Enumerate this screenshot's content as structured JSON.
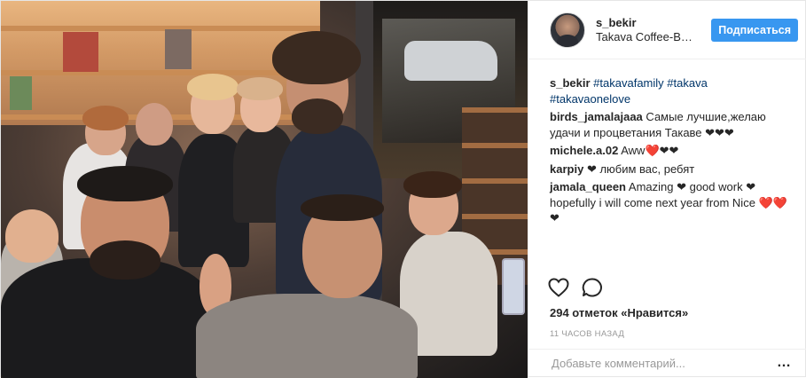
{
  "header": {
    "username": "s_bekir",
    "location": "Takava Coffee-B…",
    "follow_label": "Подписаться"
  },
  "caption": {
    "username": "s_bekir",
    "tags": [
      "#takavafamily",
      "#takava",
      "#takavaonelove"
    ]
  },
  "comments": [
    {
      "username": "birds_jamalajaaa",
      "text": "Самые лучшие,желаю удачи и процветания Такаве ❤❤❤"
    },
    {
      "username": "michele.a.02",
      "text": "Aww❤️❤❤"
    },
    {
      "username": "karpiy",
      "text": "❤ любим вас, ребят"
    },
    {
      "username": "jamala_queen",
      "text": "Amazing ❤ good work ❤ hopefully i will come next year from Nice ❤️❤️ ❤"
    }
  ],
  "actions": {
    "like_icon": "heart-icon",
    "comment_icon": "comment-icon"
  },
  "likes_text": "294 отметок «Нравится»",
  "timestamp": "11 часов назад",
  "add_comment_placeholder": "Добавьте комментарий...",
  "more_icon": "…",
  "colors": {
    "accent": "#3897f0",
    "hashtag": "#003569",
    "muted": "#999999"
  }
}
